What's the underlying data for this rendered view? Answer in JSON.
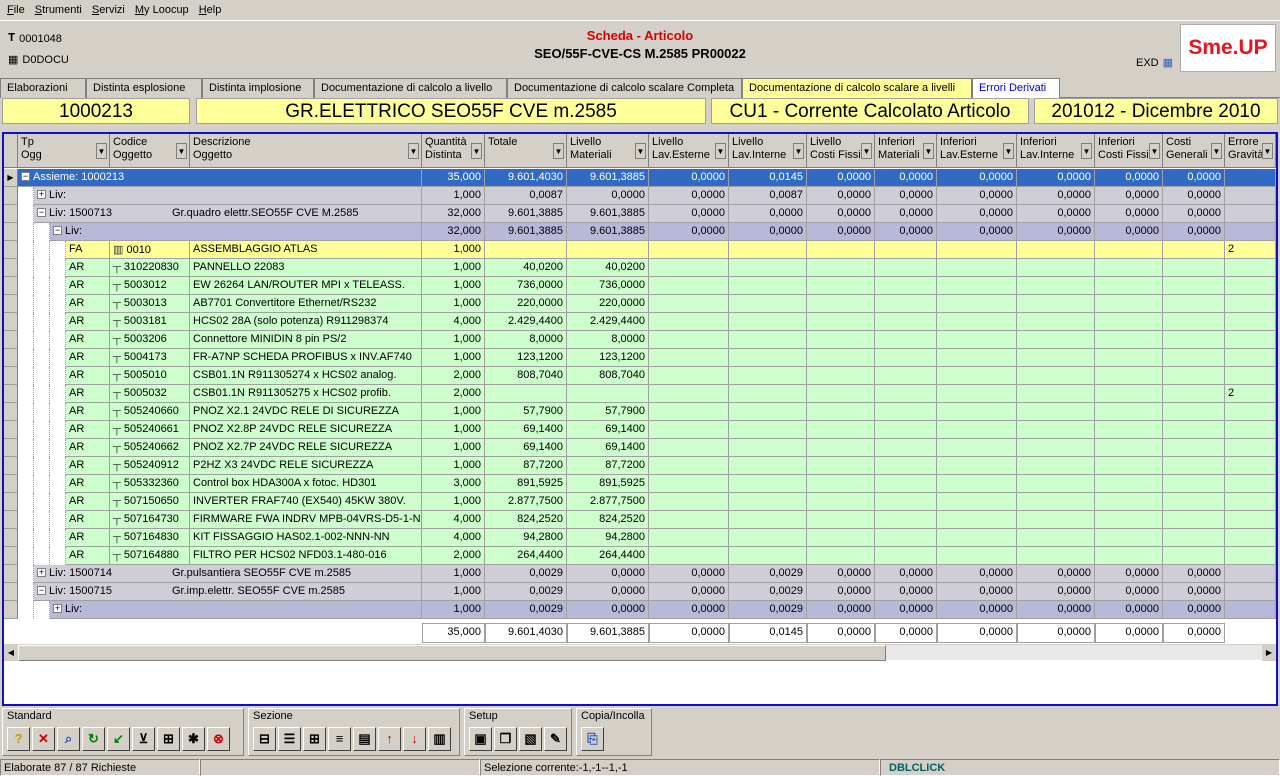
{
  "menu": [
    "File",
    "Strumenti",
    "Servizi",
    "My Loocup",
    "Help"
  ],
  "header": {
    "code1": "0001048",
    "code2": "D0DOCU",
    "title": "Scheda - Articolo",
    "subtitle": "SEO/55F-CVE-CS M.2585 PR00022",
    "exd": "EXD",
    "logo": "Sme.UP"
  },
  "tabs": [
    "Elaborazioni",
    "Distinta esplosione",
    "Distinta implosione",
    "Documentazione di calcolo a livello",
    "Documentazione di calcolo scalare Completa",
    "Documentazione di calcolo scalare a livelli",
    "Errori Derivati"
  ],
  "bigfields": [
    "1000213",
    "GR.ELETTRICO SEO55F CVE m.2585",
    "CU1 - Corrente Calcolato Articolo",
    "201012 - Dicembre 2010"
  ],
  "columns": [
    [
      "Tp",
      "Ogg"
    ],
    [
      "Codice",
      "Oggetto"
    ],
    [
      "Descrizione",
      "Oggetto"
    ],
    [
      "Quantità",
      "Distinta"
    ],
    [
      "Totale",
      ""
    ],
    [
      "Livello",
      "Materiali"
    ],
    [
      "Livello",
      "Lav.Esterne"
    ],
    [
      "Livello",
      "Lav.Interne"
    ],
    [
      "Livello",
      "Costi Fissi"
    ],
    [
      "Inferiori",
      "Materiali"
    ],
    [
      "Inferiori",
      "Lav.Esterne"
    ],
    [
      "Inferiori",
      "Lav.Interne"
    ],
    [
      "Inferiori",
      "Costi Fissi"
    ],
    [
      "Costi",
      "Generali"
    ],
    [
      "Errore",
      "Gravità"
    ]
  ],
  "rows": [
    {
      "type": "sel",
      "indent": 0,
      "exp": "−",
      "label": "Assieme: 1000213",
      "vals": [
        "35,000",
        "9.601,4030",
        "9.601,3885",
        "0,0000",
        "0,0145",
        "0,0000",
        "0,0000",
        "0,0000",
        "0,0000",
        "0,0000",
        "0,0000",
        ""
      ]
    },
    {
      "type": "grp",
      "indent": 1,
      "exp": "+",
      "label": "Liv:",
      "vals": [
        "1,000",
        "0,0087",
        "0,0000",
        "0,0000",
        "0,0087",
        "0,0000",
        "0,0000",
        "0,0000",
        "0,0000",
        "0,0000",
        "0,0000",
        ""
      ]
    },
    {
      "type": "grp",
      "indent": 1,
      "exp": "−",
      "label": "Liv: 1500713",
      "desc": "Gr.quadro elettr.SEO55F CVE M.2585",
      "vals": [
        "32,000",
        "9.601,3885",
        "9.601,3885",
        "0,0000",
        "0,0000",
        "0,0000",
        "0,0000",
        "0,0000",
        "0,0000",
        "0,0000",
        "0,0000",
        ""
      ]
    },
    {
      "type": "grp2",
      "indent": 2,
      "exp": "−",
      "label": "Liv:",
      "vals": [
        "32,000",
        "9.601,3885",
        "9.601,3885",
        "0,0000",
        "0,0000",
        "0,0000",
        "0,0000",
        "0,0000",
        "0,0000",
        "0,0000",
        "0,0000",
        ""
      ]
    },
    {
      "type": "fa",
      "tp": "FA",
      "code": "0010",
      "desc": "ASSEMBLAGGIO ATLAS",
      "vals": [
        "1,000",
        "",
        "",
        "",
        "",
        "",
        "",
        "",
        "",
        "",
        "",
        "2"
      ]
    },
    {
      "type": "ar",
      "tp": "AR",
      "code": "310220830",
      "desc": "PANNELLO                22083",
      "vals": [
        "1,000",
        "40,0200",
        "40,0200",
        "",
        "",
        "",
        "",
        "",
        "",
        "",
        "",
        ""
      ]
    },
    {
      "type": "ar",
      "tp": "AR",
      "code": "5003012",
      "desc": "EW 26264 LAN/ROUTER MPI x TELEASS.",
      "vals": [
        "1,000",
        "736,0000",
        "736,0000",
        "",
        "",
        "",
        "",
        "",
        "",
        "",
        "",
        ""
      ]
    },
    {
      "type": "ar",
      "tp": "AR",
      "code": "5003013",
      "desc": "AB7701 Convertitore Ethernet/RS232",
      "vals": [
        "1,000",
        "220,0000",
        "220,0000",
        "",
        "",
        "",
        "",
        "",
        "",
        "",
        "",
        ""
      ]
    },
    {
      "type": "ar",
      "tp": "AR",
      "code": "5003181",
      "desc": "HCS02 28A (solo potenza) R911298374",
      "vals": [
        "4,000",
        "2.429,4400",
        "2.429,4400",
        "",
        "",
        "",
        "",
        "",
        "",
        "",
        "",
        ""
      ]
    },
    {
      "type": "ar",
      "tp": "AR",
      "code": "5003206",
      "desc": "Connettore MINIDIN 8 pin PS/2",
      "vals": [
        "1,000",
        "8,0000",
        "8,0000",
        "",
        "",
        "",
        "",
        "",
        "",
        "",
        "",
        ""
      ]
    },
    {
      "type": "ar",
      "tp": "AR",
      "code": "5004173",
      "desc": "FR-A7NP SCHEDA PROFIBUS x INV.AF740",
      "vals": [
        "1,000",
        "123,1200",
        "123,1200",
        "",
        "",
        "",
        "",
        "",
        "",
        "",
        "",
        ""
      ]
    },
    {
      "type": "ar",
      "tp": "AR",
      "code": "5005010",
      "desc": "CSB01.1N R911305274 x HCS02 analog.",
      "vals": [
        "2,000",
        "808,7040",
        "808,7040",
        "",
        "",
        "",
        "",
        "",
        "",
        "",
        "",
        ""
      ]
    },
    {
      "type": "ar",
      "tp": "AR",
      "code": "5005032",
      "desc": "CSB01.1N R911305275 x HCS02 profib.",
      "vals": [
        "2,000",
        "",
        "",
        "",
        "",
        "",
        "",
        "",
        "",
        "",
        "",
        "2"
      ]
    },
    {
      "type": "ar",
      "tp": "AR",
      "code": "505240660",
      "desc": "PNOZ X2.1 24VDC RELE DI SICUREZZA",
      "vals": [
        "1,000",
        "57,7900",
        "57,7900",
        "",
        "",
        "",
        "",
        "",
        "",
        "",
        "",
        ""
      ]
    },
    {
      "type": "ar",
      "tp": "AR",
      "code": "505240661",
      "desc": "PNOZ X2.8P 24VDC RELE SICUREZZA",
      "vals": [
        "1,000",
        "69,1400",
        "69,1400",
        "",
        "",
        "",
        "",
        "",
        "",
        "",
        "",
        ""
      ]
    },
    {
      "type": "ar",
      "tp": "AR",
      "code": "505240662",
      "desc": "PNOZ X2.7P 24VDC RELE SICUREZZA",
      "vals": [
        "1,000",
        "69,1400",
        "69,1400",
        "",
        "",
        "",
        "",
        "",
        "",
        "",
        "",
        ""
      ]
    },
    {
      "type": "ar",
      "tp": "AR",
      "code": "505240912",
      "desc": "P2HZ X3 24VDC RELE SICUREZZA",
      "vals": [
        "1,000",
        "87,7200",
        "87,7200",
        "",
        "",
        "",
        "",
        "",
        "",
        "",
        "",
        ""
      ]
    },
    {
      "type": "ar",
      "tp": "AR",
      "code": "505332360",
      "desc": "Control box HDA300A x fotoc. HD301",
      "vals": [
        "3,000",
        "891,5925",
        "891,5925",
        "",
        "",
        "",
        "",
        "",
        "",
        "",
        "",
        ""
      ]
    },
    {
      "type": "ar",
      "tp": "AR",
      "code": "507150650",
      "desc": "INVERTER FRAF740 (EX540) 45KW 380V.",
      "vals": [
        "1,000",
        "2.877,7500",
        "2.877,7500",
        "",
        "",
        "",
        "",
        "",
        "",
        "",
        "",
        ""
      ]
    },
    {
      "type": "ar",
      "tp": "AR",
      "code": "507164730",
      "desc": "FIRMWARE FWA INDRV MPB-04VRS-D5-1-N",
      "vals": [
        "4,000",
        "824,2520",
        "824,2520",
        "",
        "",
        "",
        "",
        "",
        "",
        "",
        "",
        ""
      ]
    },
    {
      "type": "ar",
      "tp": "AR",
      "code": "507164830",
      "desc": "KIT FISSAGGIO HAS02.1-002-NNN-NN",
      "vals": [
        "4,000",
        "94,2800",
        "94,2800",
        "",
        "",
        "",
        "",
        "",
        "",
        "",
        "",
        ""
      ]
    },
    {
      "type": "ar",
      "tp": "AR",
      "code": "507164880",
      "desc": "FILTRO PER HCS02 NFD03.1-480-016",
      "vals": [
        "2,000",
        "264,4400",
        "264,4400",
        "",
        "",
        "",
        "",
        "",
        "",
        "",
        "",
        ""
      ]
    },
    {
      "type": "grp",
      "indent": 1,
      "exp": "+",
      "label": "Liv: 1500714",
      "desc": "Gr.pulsantiera SEO55F CVE m.2585",
      "vals": [
        "1,000",
        "0,0029",
        "0,0000",
        "0,0000",
        "0,0029",
        "0,0000",
        "0,0000",
        "0,0000",
        "0,0000",
        "0,0000",
        "0,0000",
        ""
      ]
    },
    {
      "type": "grp",
      "indent": 1,
      "exp": "−",
      "label": "Liv: 1500715",
      "desc": "Gr.imp.elettr. SEO55F CVE m.2585",
      "vals": [
        "1,000",
        "0,0029",
        "0,0000",
        "0,0000",
        "0,0029",
        "0,0000",
        "0,0000",
        "0,0000",
        "0,0000",
        "0,0000",
        "0,0000",
        ""
      ]
    },
    {
      "type": "grp2",
      "indent": 2,
      "exp": "+",
      "label": "Liv:",
      "vals": [
        "1,000",
        "0,0029",
        "0,0000",
        "0,0000",
        "0,0029",
        "0,0000",
        "0,0000",
        "0,0000",
        "0,0000",
        "0,0000",
        "0,0000",
        ""
      ]
    }
  ],
  "totals": [
    "35,000",
    "9.601,4030",
    "9.601,3885",
    "0,0000",
    "0,0145",
    "0,0000",
    "0,0000",
    "0,0000",
    "0,0000",
    "0,0000",
    "0,0000"
  ],
  "toolbar": {
    "groups": [
      {
        "label": "Standard",
        "icons": [
          "help-icon",
          "cancel-icon",
          "zoom-icon",
          "refresh-icon",
          "export-icon",
          "cart-icon",
          "import-icon",
          "search-icon",
          "stop-icon"
        ]
      },
      {
        "label": "Sezione",
        "icons": [
          "tree-icon",
          "list-icon",
          "tree-add-icon",
          "tree-level-icon",
          "table-icon",
          "up-arrow-icon",
          "down-arrow-icon",
          "columns-icon"
        ]
      },
      {
        "label": "Setup",
        "icons": [
          "save-icon",
          "copy-setup-icon",
          "save-as-icon",
          "edit-setup-icon"
        ]
      },
      {
        "label": "Copia/Incolla",
        "icons": [
          "clipboard-icon"
        ]
      }
    ]
  },
  "status": {
    "left": "Elaborate 87 / 87 Richieste",
    "middle": "",
    "selection": "Selezione corrente:-1,-1--1,-1",
    "event": "DBLCLICK"
  }
}
